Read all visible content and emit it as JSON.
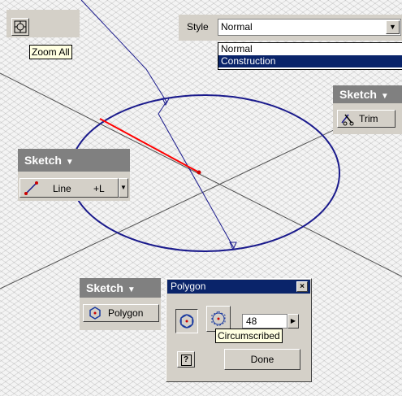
{
  "zoom": {
    "tooltip": "Zoom All",
    "icon": "zoom-all-icon"
  },
  "style": {
    "label": "Style",
    "value": "Normal",
    "options": [
      "Normal",
      "Construction"
    ],
    "selected_index": 1
  },
  "sketch_toolbar_right": {
    "title": "Sketch",
    "item": {
      "label": "Trim",
      "icon": "trim-icon"
    }
  },
  "sketch_toolbar_left": {
    "title": "Sketch",
    "item": {
      "label": "Line",
      "shortcut": "+L",
      "icon": "line-icon"
    }
  },
  "sketch_toolbar_bottom": {
    "title": "Sketch",
    "item": {
      "label": "Polygon",
      "icon": "polygon-icon"
    }
  },
  "polygon_dialog": {
    "title": "Polygon",
    "sides": "48",
    "tooltip": "Circumscribed",
    "done_label": "Done",
    "help_label": "?"
  },
  "colors": {
    "curve": "#1a1a8c",
    "highlight": "#ff0000",
    "titlebar": "#0a246a",
    "toolbar_header": "#808080",
    "panel": "#d4d0c8",
    "tooltip": "#ffffe1"
  }
}
